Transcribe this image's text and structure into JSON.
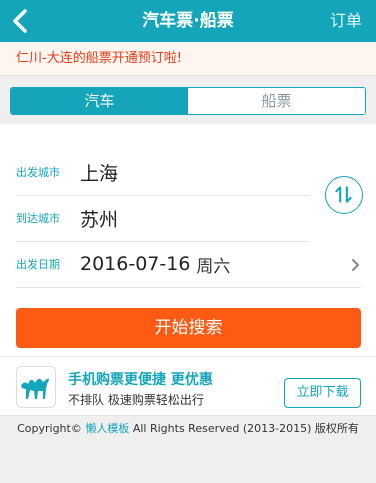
{
  "header": {
    "title": "汽车票·船票",
    "orders_label": "订单"
  },
  "notice": {
    "text": "仁川-大连的船票开通预订啦!"
  },
  "tabs": [
    {
      "label": "汽车",
      "active": true
    },
    {
      "label": "船票",
      "active": false
    }
  ],
  "form": {
    "from": {
      "label": "出发城市",
      "value": "上海"
    },
    "to": {
      "label": "到达城市",
      "value": "苏州"
    },
    "date": {
      "label": "出发日期",
      "value": "2016-07-16",
      "weekday": "周六"
    },
    "search_label": "开始搜索"
  },
  "promo": {
    "title": "手机购票更便捷 更优惠",
    "subtitle": "不排队 极速购票轻松出行",
    "download_label": "立即下载"
  },
  "footer": {
    "prefix": "Copyright©",
    "brand": "懒人模板",
    "suffix": "All Rights Reserved (2013-2015) 版权所有"
  },
  "colors": {
    "primary": "#14a5bb",
    "accent": "#fd5a13",
    "notice_text": "#e53b16"
  },
  "icons": {
    "back": "chevron-left-icon",
    "swap": "swap-arrows-icon",
    "more": "chevron-right-icon",
    "logo": "camel-logo-icon"
  }
}
